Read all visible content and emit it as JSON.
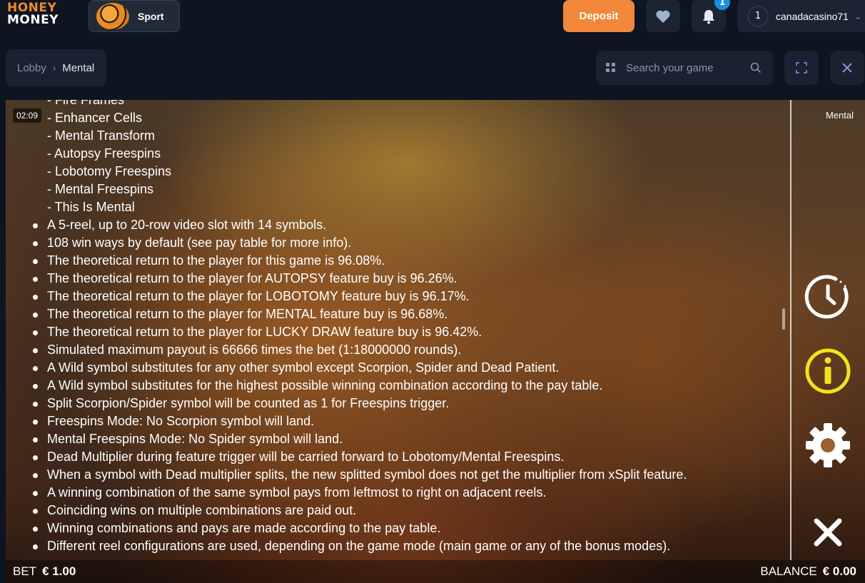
{
  "header": {
    "logo_line1": "HONEY",
    "logo_line2": "MONEY",
    "sport_label": "Sport",
    "deposit_label": "Deposit",
    "notification_count": "1",
    "user_level": "1",
    "username": "canadacasino71"
  },
  "breadcrumb": {
    "lobby": "Lobby",
    "current": "Mental"
  },
  "search": {
    "placeholder": "Search your game"
  },
  "game": {
    "timer": "02:09",
    "title": "Mental",
    "sub_items": [
      "- Fire Frames",
      "- Enhancer Cells",
      "- Mental Transform",
      "- Autopsy Freespins",
      "- Lobotomy Freespins",
      "- Mental Freespins",
      "- This Is Mental"
    ],
    "bullets": [
      "A 5-reel, up to 20-row video slot with 14 symbols.",
      "108 win ways by default (see pay table for more info).",
      "The theoretical return to the player for this game is 96.08%.",
      "The theoretical return to the player for AUTOPSY feature buy is 96.26%.",
      "The theoretical return to the player for LOBOTOMY feature buy is 96.17%.",
      "The theoretical return to the player for MENTAL feature buy is 96.68%.",
      "The theoretical return to the player for LUCKY DRAW feature buy is 96.42%.",
      "Simulated maximum payout is 66666 times the bet (1:18000000 rounds).",
      "A Wild symbol substitutes for any other symbol except Scorpion, Spider and Dead Patient.",
      "A Wild symbol substitutes for the highest possible winning combination according to the pay table.",
      "Split Scorpion/Spider symbol will be counted as 1 for Freespins trigger.",
      "Freespins Mode: No Scorpion symbol will land.",
      "Mental Freespins Mode: No Spider symbol will land.",
      "Dead Multiplier during feature trigger will be carried forward to Lobotomy/Mental Freespins.",
      "When a symbol with Dead multiplier splits, the new splitted symbol does not get the multiplier from xSplit feature.",
      "A winning combination of the same symbol pays from leftmost to right on adjacent reels.",
      "Coinciding wins on multiple combinations are paid out.",
      "Winning combinations and pays are made according to the pay table.",
      "Different reel configurations are used, depending on the game mode (main game or any of the bonus modes)."
    ],
    "bet_label": "BET",
    "bet_value": "€ 1.00",
    "balance_label": "BALANCE",
    "balance_value": "€ 0.00"
  },
  "colors": {
    "accent": "#f0873a",
    "info_yellow": "#f2e21c",
    "badge_blue": "#1d8fe0"
  }
}
